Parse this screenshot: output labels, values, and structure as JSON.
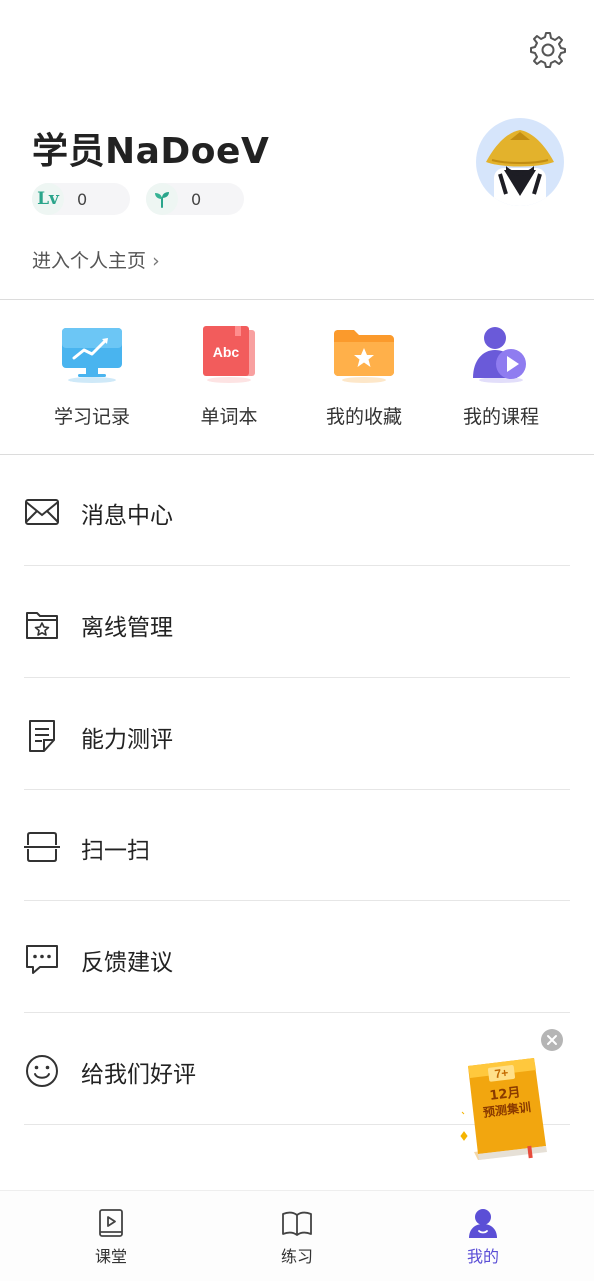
{
  "profile": {
    "username": "学员NaDoeV",
    "level_badge": "Lv",
    "level_value": "0",
    "sprout_value": "0",
    "homepage_link": "进入个人主页",
    "homepage_chevron": "›"
  },
  "quick_actions": [
    {
      "label": "学习记录",
      "icon": "monitor-chart-icon"
    },
    {
      "label": "单词本",
      "icon": "abc-notebook-icon"
    },
    {
      "label": "我的收藏",
      "icon": "star-folder-icon"
    },
    {
      "label": "我的课程",
      "icon": "person-play-icon"
    }
  ],
  "icon_badge": {
    "abc": "Abc"
  },
  "menu": [
    {
      "label": "消息中心",
      "icon": "mail-icon"
    },
    {
      "label": "离线管理",
      "icon": "star-folder-outline-icon"
    },
    {
      "label": "能力测评",
      "icon": "document-edit-icon"
    },
    {
      "label": "扫一扫",
      "icon": "scan-icon"
    },
    {
      "label": "反馈建议",
      "icon": "chat-bubble-icon"
    },
    {
      "label": "给我们好评",
      "icon": "smiley-icon"
    }
  ],
  "promo": {
    "badge": "7+",
    "line1": "12月",
    "line2": "预测集训"
  },
  "nav": [
    {
      "label": "课堂",
      "icon": "classroom-icon",
      "active": false
    },
    {
      "label": "练习",
      "icon": "open-book-icon",
      "active": false
    },
    {
      "label": "我的",
      "icon": "profile-icon",
      "active": true
    }
  ],
  "colors": {
    "accent": "#5b4fd6",
    "level": "#2aa58b",
    "folder_orange": "#fb9a2c",
    "notebook_red": "#f25c5c",
    "monitor_blue": "#49b4ef",
    "course_purple": "#6a5ad9"
  }
}
